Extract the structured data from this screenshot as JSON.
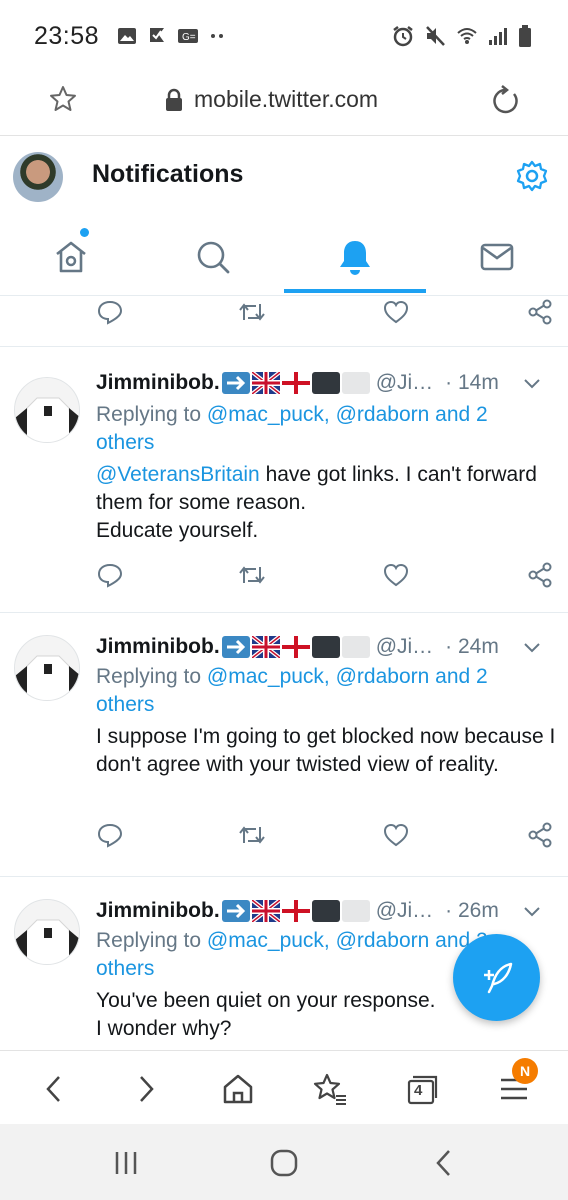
{
  "status_bar": {
    "time": "23:58",
    "left_icons": [
      "image-icon",
      "check-flag-icon",
      "g-translate-icon",
      "more-dots-icon"
    ],
    "right_icons": [
      "alarm-icon",
      "mute-icon",
      "wifi-icon",
      "signal-icon",
      "battery-icon"
    ]
  },
  "browser": {
    "url": "mobile.twitter.com",
    "tab_count": "4",
    "menu_badge": "N"
  },
  "header": {
    "title": "Notifications"
  },
  "tabs": [
    {
      "name": "home",
      "icon": "home-icon",
      "has_dot": true
    },
    {
      "name": "search",
      "icon": "search-icon"
    },
    {
      "name": "notifications",
      "icon": "bell-icon",
      "active": true
    },
    {
      "name": "messages",
      "icon": "envelope-icon"
    }
  ],
  "tweets": [
    {
      "name": "Jimminibob.",
      "handle": "@Ji…",
      "time": "· 14m",
      "replying_prefix": "Replying to ",
      "replying_mentions": "@mac_puck, @rdaborn and 2 others",
      "mention_link": "@VeteransBritain",
      "text": " have got links. I can't forward them for some reason.\nEducate yourself."
    },
    {
      "name": "Jimminibob.",
      "handle": "@Ji…",
      "time": "· 24m",
      "replying_prefix": "Replying to ",
      "replying_mentions": "@mac_puck, @rdaborn and 2 others",
      "text": "I suppose I'm going to get blocked now because I don't agree with your twisted view of reality."
    },
    {
      "name": "Jimminibob.",
      "handle": "@Ji…",
      "time": "· 26m",
      "replying_prefix": "Replying to ",
      "replying_mentions": "@mac_puck, @rdaborn and 2 others",
      "text": "You've been quiet on your response.\nI wonder why?"
    }
  ],
  "colors": {
    "accent": "#1da1f2",
    "link": "#1b95e0",
    "secondary_text": "#657786",
    "badge": "#f57c00"
  }
}
